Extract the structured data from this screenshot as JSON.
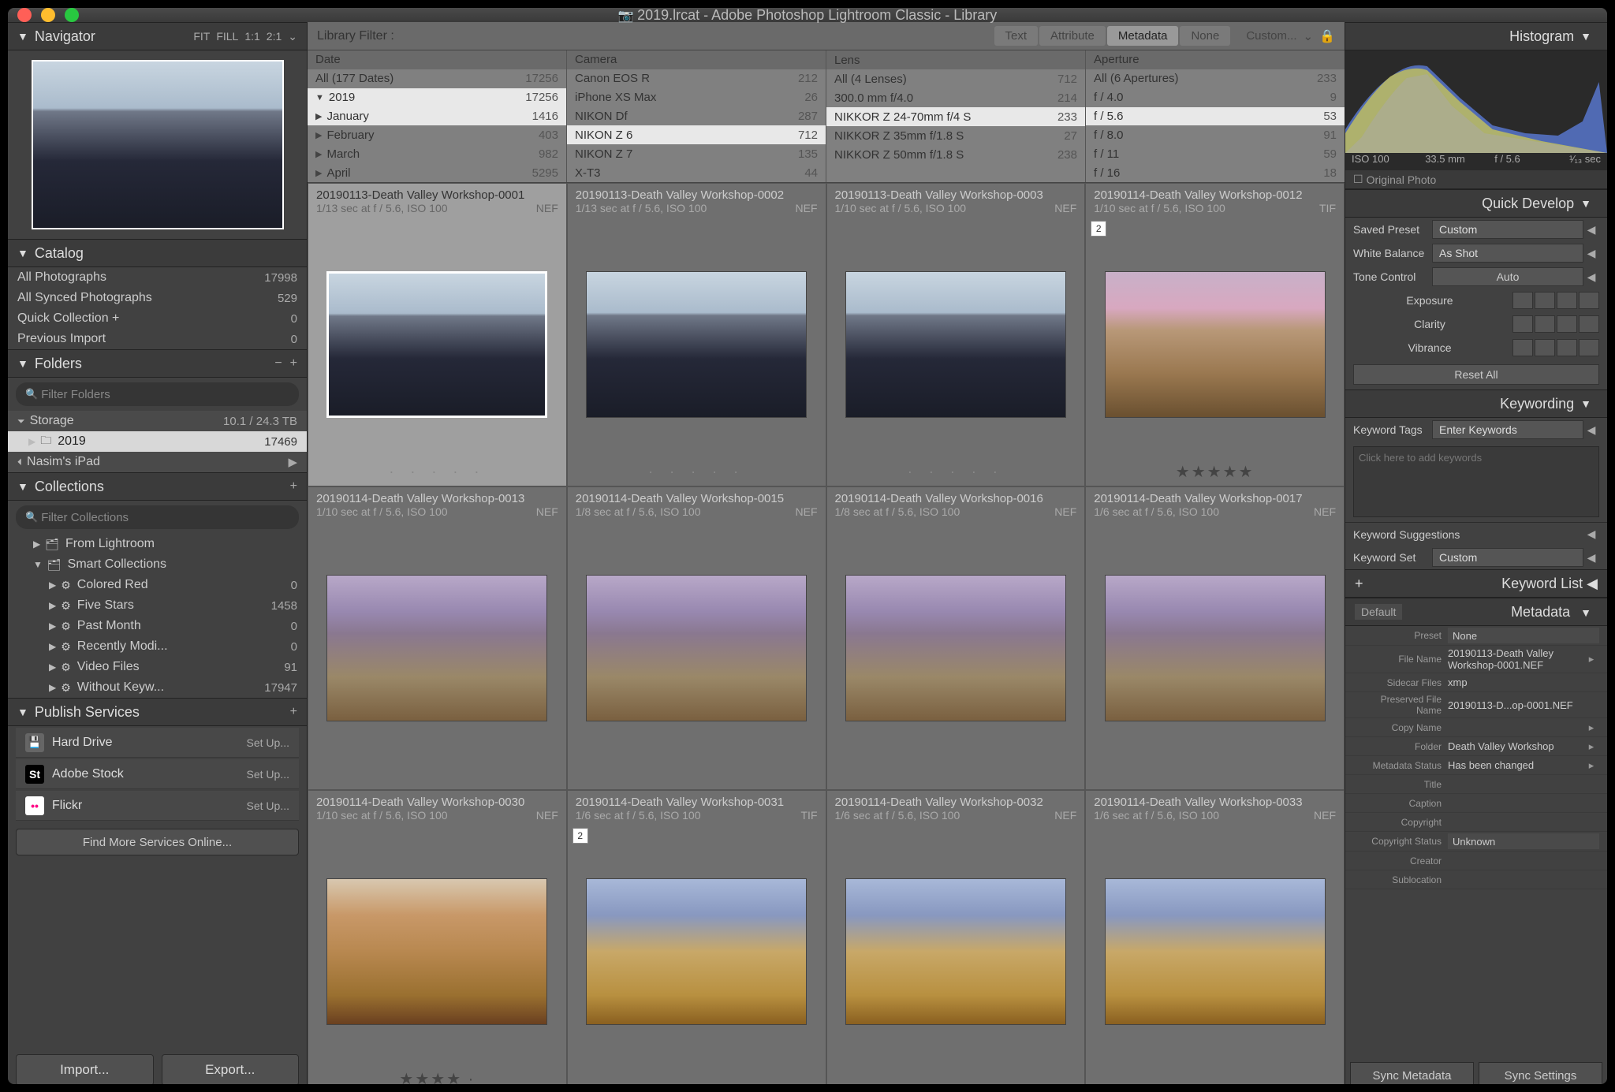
{
  "window_title": "2019.lrcat - Adobe Photoshop Lightroom Classic - Library",
  "nav": {
    "title": "Navigator",
    "opts": [
      "FIT",
      "FILL",
      "1:1",
      "2:1"
    ]
  },
  "catalog": {
    "title": "Catalog",
    "rows": [
      {
        "label": "All Photographs",
        "count": "17998"
      },
      {
        "label": "All Synced Photographs",
        "count": "529"
      },
      {
        "label": "Quick Collection  +",
        "count": "0"
      },
      {
        "label": "Previous Import",
        "count": "0"
      }
    ]
  },
  "folders": {
    "title": "Folders",
    "filter_placeholder": "Filter Folders",
    "storage_label": "Storage",
    "storage_info": "10.1 / 24.3 TB",
    "year": "2019",
    "year_count": "17469",
    "ipad": "Nasim's iPad"
  },
  "collections": {
    "title": "Collections",
    "filter_placeholder": "Filter Collections",
    "rows": [
      {
        "label": "From Lightroom",
        "count": "",
        "ind": 1,
        "tri": "▶",
        "icon": "🗂"
      },
      {
        "label": "Smart Collections",
        "count": "",
        "ind": 1,
        "tri": "▼",
        "icon": "🗂"
      },
      {
        "label": "Colored Red",
        "count": "0",
        "ind": 2,
        "tri": "▶",
        "icon": "⚙"
      },
      {
        "label": "Five Stars",
        "count": "1458",
        "ind": 2,
        "tri": "▶",
        "icon": "⚙"
      },
      {
        "label": "Past Month",
        "count": "0",
        "ind": 2,
        "tri": "▶",
        "icon": "⚙"
      },
      {
        "label": "Recently Modi...",
        "count": "0",
        "ind": 2,
        "tri": "▶",
        "icon": "⚙"
      },
      {
        "label": "Video Files",
        "count": "91",
        "ind": 2,
        "tri": "▶",
        "icon": "⚙"
      },
      {
        "label": "Without Keyw...",
        "count": "17947",
        "ind": 2,
        "tri": "▶",
        "icon": "⚙"
      }
    ]
  },
  "publish": {
    "title": "Publish Services",
    "rows": [
      {
        "label": "Hard Drive",
        "setup": "Set Up...",
        "bg": "#666",
        "fg": "#fff",
        "icon": "💾"
      },
      {
        "label": "Adobe Stock",
        "setup": "Set Up...",
        "bg": "#000",
        "fg": "#fff",
        "icon": "St"
      },
      {
        "label": "Flickr",
        "setup": "Set Up...",
        "bg": "#fff",
        "fg": "#ff0084",
        "icon": "••"
      }
    ],
    "find_more": "Find More Services Online..."
  },
  "import_btn": "Import...",
  "export_btn": "Export...",
  "libfilter": {
    "title": "Library Filter :",
    "tabs": [
      "Text",
      "Attribute",
      "Metadata",
      "None"
    ],
    "active": 2,
    "custom": "Custom..."
  },
  "metacols": [
    {
      "header": "Date",
      "rows": [
        {
          "label": "All (177 Dates)",
          "count": "17256",
          "sel": false,
          "tri": ""
        },
        {
          "label": "2019",
          "count": "17256",
          "sel": true,
          "tri": "▼"
        },
        {
          "label": "January",
          "count": "1416",
          "sel": true,
          "tri": "▶"
        },
        {
          "label": "February",
          "count": "403",
          "sel": false,
          "tri": "▶"
        },
        {
          "label": "March",
          "count": "982",
          "sel": false,
          "tri": "▶"
        },
        {
          "label": "April",
          "count": "5295",
          "sel": false,
          "tri": "▶"
        }
      ]
    },
    {
      "header": "Camera",
      "rows": [
        {
          "label": "Canon EOS R",
          "count": "212",
          "sel": false
        },
        {
          "label": "iPhone XS Max",
          "count": "26",
          "sel": false
        },
        {
          "label": "NIKON Df",
          "count": "287",
          "sel": false
        },
        {
          "label": "NIKON Z 6",
          "count": "712",
          "sel": true
        },
        {
          "label": "NIKON Z 7",
          "count": "135",
          "sel": false
        },
        {
          "label": "X-T3",
          "count": "44",
          "sel": false
        }
      ]
    },
    {
      "header": "Lens",
      "rows": [
        {
          "label": "All (4 Lenses)",
          "count": "712",
          "sel": false
        },
        {
          "label": "300.0 mm f/4.0",
          "count": "214",
          "sel": false
        },
        {
          "label": "NIKKOR Z 24-70mm f/4 S",
          "count": "233",
          "sel": true
        },
        {
          "label": "NIKKOR Z 35mm f/1.8 S",
          "count": "27",
          "sel": false
        },
        {
          "label": "NIKKOR Z 50mm f/1.8 S",
          "count": "238",
          "sel": false
        }
      ]
    },
    {
      "header": "Aperture",
      "rows": [
        {
          "label": "All (6 Apertures)",
          "count": "233",
          "sel": false
        },
        {
          "label": "f / 4.0",
          "count": "9",
          "sel": false
        },
        {
          "label": "f / 5.6",
          "count": "53",
          "sel": true
        },
        {
          "label": "f / 8.0",
          "count": "91",
          "sel": false
        },
        {
          "label": "f / 11",
          "count": "59",
          "sel": false
        },
        {
          "label": "f / 16",
          "count": "18",
          "sel": false
        }
      ]
    }
  ],
  "cells": [
    {
      "name": "20190113-Death Valley Workshop-0001",
      "sub": "1/13 sec at f / 5.6, ISO 100",
      "fmt": "NEF",
      "thumb": "dunes",
      "active": true,
      "dots": true
    },
    {
      "name": "20190113-Death Valley Workshop-0002",
      "sub": "1/13 sec at f / 5.6, ISO 100",
      "fmt": "NEF",
      "thumb": "dunes",
      "dots": true
    },
    {
      "name": "20190113-Death Valley Workshop-0003",
      "sub": "1/10 sec at f / 5.6, ISO 100",
      "fmt": "NEF",
      "thumb": "dunes",
      "dots": true
    },
    {
      "name": "20190114-Death Valley Workshop-0012",
      "sub": "1/10 sec at f / 5.6, ISO 100",
      "fmt": "TIF",
      "thumb": "zab1",
      "stars": "★★★★★",
      "badge": "2"
    },
    {
      "name": "20190114-Death Valley Workshop-0013",
      "sub": "1/10 sec at f / 5.6, ISO 100",
      "fmt": "NEF",
      "thumb": "zab2"
    },
    {
      "name": "20190114-Death Valley Workshop-0015",
      "sub": "1/8 sec at f / 5.6, ISO 100",
      "fmt": "NEF",
      "thumb": "zab2"
    },
    {
      "name": "20190114-Death Valley Workshop-0016",
      "sub": "1/8 sec at f / 5.6, ISO 100",
      "fmt": "NEF",
      "thumb": "zab2"
    },
    {
      "name": "20190114-Death Valley Workshop-0017",
      "sub": "1/6 sec at f / 5.6, ISO 100",
      "fmt": "NEF",
      "thumb": "zab2"
    },
    {
      "name": "20190114-Death Valley Workshop-0030",
      "sub": "1/10 sec at f / 5.6, ISO 100",
      "fmt": "NEF",
      "thumb": "zab3",
      "stars": "★★★★ ·"
    },
    {
      "name": "20190114-Death Valley Workshop-0031",
      "sub": "1/6 sec at f / 5.6, ISO 100",
      "fmt": "TIF",
      "thumb": "zab4",
      "badge": "2"
    },
    {
      "name": "20190114-Death Valley Workshop-0032",
      "sub": "1/6 sec at f / 5.6, ISO 100",
      "fmt": "NEF",
      "thumb": "zab4"
    },
    {
      "name": "20190114-Death Valley Workshop-0033",
      "sub": "1/6 sec at f / 5.6, ISO 100",
      "fmt": "NEF",
      "thumb": "zab4"
    }
  ],
  "hist": {
    "title": "Histogram",
    "labels": [
      "ISO 100",
      "33.5 mm",
      "f / 5.6",
      "¹⁄₁₃ sec"
    ],
    "original": "Original Photo"
  },
  "qd": {
    "title": "Quick Develop",
    "preset_label": "Saved Preset",
    "preset_val": "Custom",
    "wb_label": "White Balance",
    "wb_val": "As Shot",
    "tone_label": "Tone Control",
    "auto": "Auto",
    "exposure": "Exposure",
    "clarity": "Clarity",
    "vibrance": "Vibrance",
    "reset": "Reset All"
  },
  "kw": {
    "title": "Keywording",
    "tags_label": "Keyword Tags",
    "tags_val": "Enter Keywords",
    "place": "Click here to add keywords",
    "sugg": "Keyword Suggestions",
    "set_label": "Keyword Set",
    "set_val": "Custom",
    "list": "Keyword List",
    "default": "Default"
  },
  "md": {
    "title": "Metadata",
    "preset_label": "Preset",
    "preset_val": "None",
    "rows": [
      {
        "l": "File Name",
        "v": "20190113-Death Valley Workshop-0001.NEF",
        "go": true
      },
      {
        "l": "Sidecar Files",
        "v": "xmp"
      },
      {
        "l": "Preserved File Name",
        "v": "20190113-D...op-0001.NEF"
      },
      {
        "l": "Copy Name",
        "v": "",
        "go": true
      },
      {
        "l": "Folder",
        "v": "Death Valley Workshop",
        "go": true
      },
      {
        "l": "Metadata Status",
        "v": "Has been changed",
        "go": true
      },
      {
        "l": "Title",
        "v": ""
      },
      {
        "l": "Caption",
        "v": ""
      },
      {
        "l": "Copyright",
        "v": ""
      },
      {
        "l": "Copyright Status",
        "v": "Unknown",
        "sel": true
      },
      {
        "l": "Creator",
        "v": ""
      },
      {
        "l": "Sublocation",
        "v": ""
      }
    ],
    "sync1": "Sync Metadata",
    "sync2": "Sync Settings"
  }
}
